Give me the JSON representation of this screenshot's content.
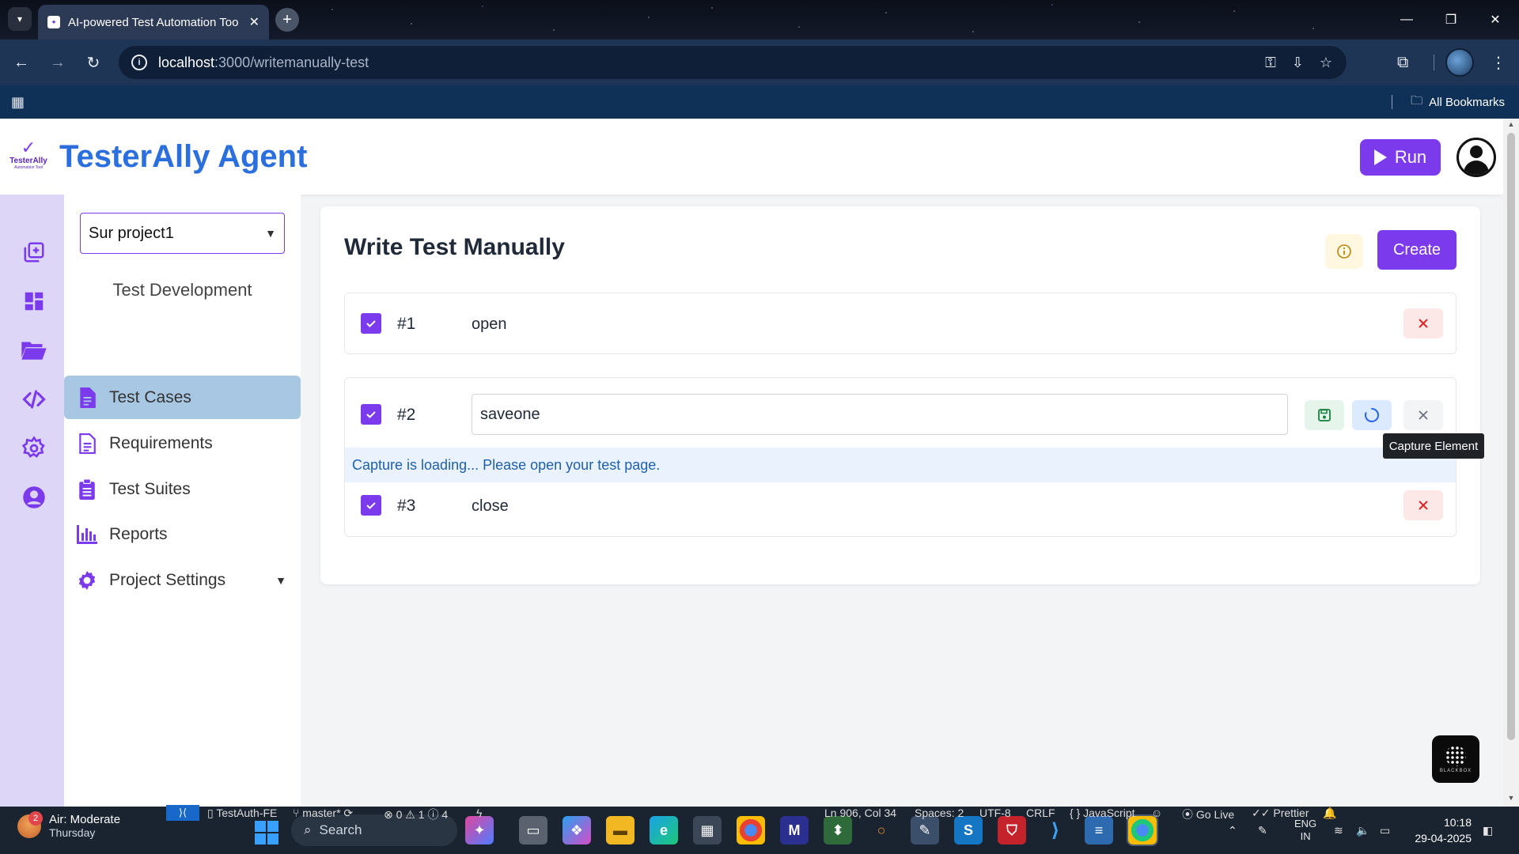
{
  "browser": {
    "tab_title": "AI-powered Test Automation Tool",
    "url_host": "localhost",
    "url_path": ":3000/writemanually-test",
    "bookmarks_label": "All Bookmarks"
  },
  "app": {
    "logo_text": "TesterAlly",
    "logo_sub": "Automation Tool",
    "brand": "TesterAlly Agent",
    "run_label": "Run"
  },
  "sidebar": {
    "project": "Sur project1",
    "section_title": "Test Development",
    "items": [
      {
        "label": "Test Cases",
        "icon": "document-icon",
        "active": true
      },
      {
        "label": "Requirements",
        "icon": "document-outline-icon",
        "active": false
      },
      {
        "label": "Test Suites",
        "icon": "clipboard-icon",
        "active": false
      },
      {
        "label": "Reports",
        "icon": "bar-chart-icon",
        "active": false
      },
      {
        "label": "Project Settings",
        "icon": "gear-icon",
        "active": false
      }
    ]
  },
  "main": {
    "title": "Write Test Manually",
    "create_label": "Create",
    "steps": [
      {
        "num": "#1",
        "text": "open",
        "checked": true
      },
      {
        "num": "#2",
        "text": "saveone",
        "checked": true,
        "editing": true
      },
      {
        "num": "#3",
        "text": "close",
        "checked": true
      }
    ],
    "loading_message": "Capture is loading... Please open your test page.",
    "tooltip": "Capture Element"
  },
  "widgets": {
    "blackbox_label": "BLACKBOX"
  },
  "vscode_status": {
    "branch_project": "TestAuth-FE",
    "branch": "master*",
    "problems": "0",
    "warnings": "1",
    "infos": "4",
    "position": "Ln 906, Col 34",
    "spaces": "Spaces: 2",
    "encoding": "UTF-8",
    "eol": "CRLF",
    "language": "JavaScript",
    "golive": "Go Live",
    "prettier": "Prettier"
  },
  "taskbar": {
    "weather_badge": "2",
    "weather_title": "Air: Moderate",
    "weather_day": "Thursday",
    "search_placeholder": "Search",
    "lang_top": "ENG",
    "lang_bottom": "IN",
    "time": "10:18",
    "date": "29-04-2025"
  },
  "colors": {
    "brand_blue": "#2b6fde",
    "accent_purple": "#7c3aed",
    "active_nav": "#a8c7e3",
    "rail_bg": "#ddd6f7"
  }
}
